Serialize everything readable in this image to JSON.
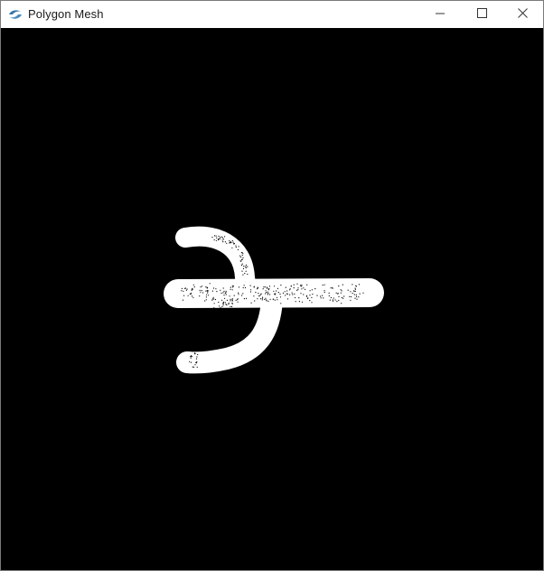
{
  "window": {
    "title": "Polygon Mesh",
    "icon": "python-snake-icon",
    "controls": {
      "minimize": "minimize-icon",
      "maximize": "maximize-icon",
      "close": "close-icon"
    }
  },
  "canvas": {
    "background": "#000000",
    "shape_fill": "#ffffff",
    "vertex_color": "#000000"
  }
}
